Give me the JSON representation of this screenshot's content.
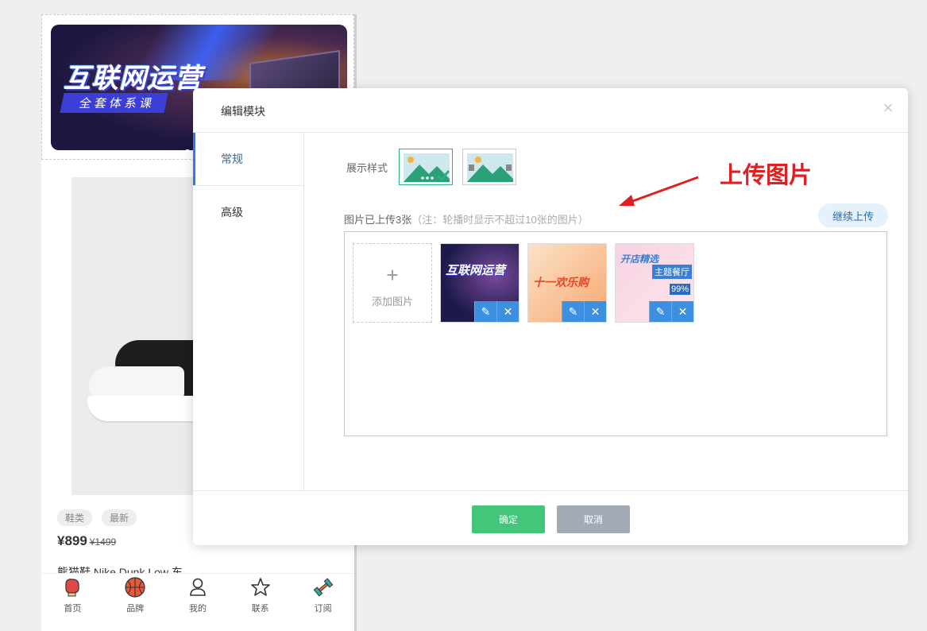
{
  "preview": {
    "banner": {
      "title": "互联网运营",
      "subtitle": "全套体系课"
    },
    "tags": [
      "鞋类",
      "最新"
    ],
    "price": {
      "now": "¥899",
      "old": "¥1499"
    },
    "product_name": "熊猫鞋 Nike Dunk Low 东",
    "tabbar": [
      {
        "label": "首页",
        "icon": "boxing-glove-icon"
      },
      {
        "label": "品牌",
        "icon": "basketball-icon"
      },
      {
        "label": "我的",
        "icon": "user-icon"
      },
      {
        "label": "联系",
        "icon": "star-icon"
      },
      {
        "label": "订阅",
        "icon": "dumbbell-icon"
      }
    ]
  },
  "modal": {
    "title": "编辑模块",
    "close_icon": "close-icon",
    "nav": [
      {
        "label": "常规",
        "active": true
      },
      {
        "label": "高级",
        "active": false
      }
    ],
    "style_label": "展示样式",
    "annotation": "上传图片",
    "upload_count": "图片已上传3张",
    "upload_note": "（注：轮播时显示不超过10张的图片）",
    "continue_upload": "继续上传",
    "add_image": "添加图片",
    "add_symbol": "+",
    "images": [
      {
        "caption": "互联网运营",
        "theme": "dark-blue"
      },
      {
        "caption": "十一欢乐购",
        "theme": "orange"
      },
      {
        "caption": "开店精选",
        "caption2": "主题餐厅",
        "percent": "99%",
        "theme": "pink"
      }
    ],
    "edit_icon": "pencil-icon",
    "delete_icon": "close-icon",
    "ok": "确定",
    "cancel": "取消"
  },
  "colors": {
    "accent_blue": "#2f7be5",
    "ok_green": "#44c67a",
    "cancel_gray": "#a2abb5",
    "annotation_red": "#e02020"
  }
}
